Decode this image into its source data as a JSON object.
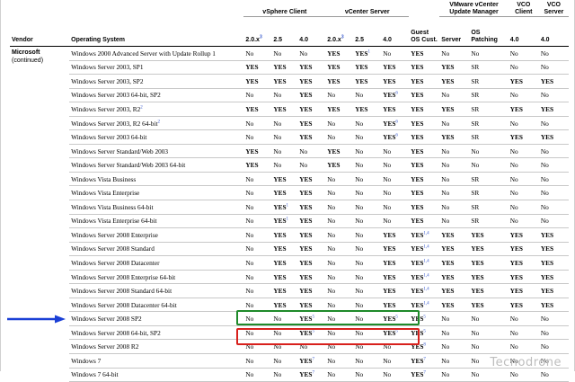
{
  "header": {
    "groups": [
      {
        "key": "vendor",
        "label": ""
      },
      {
        "key": "os",
        "label": ""
      },
      {
        "key": "vsphere",
        "label": "vSphere Client",
        "span": 3
      },
      {
        "key": "vcenter",
        "label": "vCenter Server",
        "span": 3
      },
      {
        "key": "guest",
        "label": ""
      },
      {
        "key": "vum",
        "label": "VMware vCenter Update Manager",
        "span": 2
      },
      {
        "key": "vco_client",
        "label": "VCO Client"
      },
      {
        "key": "vco_server",
        "label": "VCO Server"
      }
    ],
    "columns": [
      {
        "label": "Vendor"
      },
      {
        "label": "Operating System"
      },
      {
        "label": "2.0.x",
        "fn": "3"
      },
      {
        "label": "2.5"
      },
      {
        "label": "4.0"
      },
      {
        "label": "2.0.x",
        "fn": "3"
      },
      {
        "label": "2.5"
      },
      {
        "label": "4.0"
      },
      {
        "label": "Guest OS Cust."
      },
      {
        "label": "Server"
      },
      {
        "label": "OS Patching"
      },
      {
        "label": "4.0"
      },
      {
        "label": "4.0"
      }
    ]
  },
  "vendor": {
    "name": "Microsoft",
    "note": "(continued)"
  },
  "rows": [
    {
      "os": "Windows 2000 Advanced Server with Update Rollup 1",
      "cells": [
        [
          "No"
        ],
        [
          "No"
        ],
        [
          "No"
        ],
        [
          "YES"
        ],
        [
          "YES",
          "1"
        ],
        [
          "No"
        ],
        [
          "YES"
        ],
        [
          "No"
        ],
        [
          "No"
        ],
        [
          "No"
        ],
        [
          "No"
        ]
      ]
    },
    {
      "os": "Windows Server 2003, SP1",
      "cells": [
        [
          "YES"
        ],
        [
          "YES"
        ],
        [
          "YES"
        ],
        [
          "YES"
        ],
        [
          "YES"
        ],
        [
          "YES"
        ],
        [
          "YES"
        ],
        [
          "YES"
        ],
        [
          "SR"
        ],
        [
          "No"
        ],
        [
          "No"
        ]
      ]
    },
    {
      "os": "Windows Server 2003, SP2",
      "cells": [
        [
          "YES"
        ],
        [
          "YES"
        ],
        [
          "YES"
        ],
        [
          "YES"
        ],
        [
          "YES"
        ],
        [
          "YES"
        ],
        [
          "YES"
        ],
        [
          "YES"
        ],
        [
          "SR"
        ],
        [
          "YES"
        ],
        [
          "YES"
        ]
      ]
    },
    {
      "os": "Windows Server 2003 64-bit, SP2",
      "cells": [
        [
          "No"
        ],
        [
          "No"
        ],
        [
          "YES"
        ],
        [
          "No"
        ],
        [
          "No"
        ],
        [
          "YES",
          "6"
        ],
        [
          "YES"
        ],
        [
          "No"
        ],
        [
          "SR"
        ],
        [
          "No"
        ],
        [
          "No"
        ]
      ]
    },
    {
      "os": "Windows Server 2003, R2",
      "fn": "2",
      "cells": [
        [
          "YES"
        ],
        [
          "YES"
        ],
        [
          "YES"
        ],
        [
          "YES"
        ],
        [
          "YES"
        ],
        [
          "YES"
        ],
        [
          "YES"
        ],
        [
          "YES"
        ],
        [
          "SR"
        ],
        [
          "YES"
        ],
        [
          "YES"
        ]
      ]
    },
    {
      "os": "Windows Server 2003, R2 64-bit",
      "fn": "2",
      "cells": [
        [
          "No"
        ],
        [
          "No"
        ],
        [
          "YES"
        ],
        [
          "No"
        ],
        [
          "No"
        ],
        [
          "YES",
          "6"
        ],
        [
          "YES"
        ],
        [
          "No"
        ],
        [
          "SR"
        ],
        [
          "No"
        ],
        [
          "No"
        ]
      ]
    },
    {
      "os": "Windows Server 2003 64-bit",
      "cells": [
        [
          "No"
        ],
        [
          "No"
        ],
        [
          "YES"
        ],
        [
          "No"
        ],
        [
          "No"
        ],
        [
          "YES",
          "6"
        ],
        [
          "YES"
        ],
        [
          "YES"
        ],
        [
          "SR"
        ],
        [
          "YES"
        ],
        [
          "YES"
        ]
      ]
    },
    {
      "os": "Windows Server Standard/Web 2003",
      "cells": [
        [
          "YES"
        ],
        [
          "No"
        ],
        [
          "No"
        ],
        [
          "YES"
        ],
        [
          "No"
        ],
        [
          "No"
        ],
        [
          "YES"
        ],
        [
          "No"
        ],
        [
          "No"
        ],
        [
          "No"
        ],
        [
          "No"
        ]
      ]
    },
    {
      "os": "Windows Server Standard/Web 2003 64-bit",
      "cells": [
        [
          "YES"
        ],
        [
          "No"
        ],
        [
          "No"
        ],
        [
          "YES"
        ],
        [
          "No"
        ],
        [
          "No"
        ],
        [
          "YES"
        ],
        [
          "No"
        ],
        [
          "No"
        ],
        [
          "No"
        ],
        [
          "No"
        ]
      ]
    },
    {
      "os": "Windows Vista Business",
      "cells": [
        [
          "No"
        ],
        [
          "YES"
        ],
        [
          "YES"
        ],
        [
          "No"
        ],
        [
          "No"
        ],
        [
          "No"
        ],
        [
          "YES"
        ],
        [
          "No"
        ],
        [
          "SR"
        ],
        [
          "No"
        ],
        [
          "No"
        ]
      ]
    },
    {
      "os": "Windows Vista Enterprise",
      "cells": [
        [
          "No"
        ],
        [
          "YES"
        ],
        [
          "YES"
        ],
        [
          "No"
        ],
        [
          "No"
        ],
        [
          "No"
        ],
        [
          "YES"
        ],
        [
          "No"
        ],
        [
          "SR"
        ],
        [
          "No"
        ],
        [
          "No"
        ]
      ]
    },
    {
      "os": "Windows Vista Business 64-bit",
      "cells": [
        [
          "No"
        ],
        [
          "YES",
          "1"
        ],
        [
          "YES"
        ],
        [
          "No"
        ],
        [
          "No"
        ],
        [
          "No"
        ],
        [
          "YES"
        ],
        [
          "No"
        ],
        [
          "SR"
        ],
        [
          "No"
        ],
        [
          "No"
        ]
      ]
    },
    {
      "os": "Windows Vista Enterprise 64-bit",
      "cells": [
        [
          "No"
        ],
        [
          "YES",
          "1"
        ],
        [
          "YES"
        ],
        [
          "No"
        ],
        [
          "No"
        ],
        [
          "No"
        ],
        [
          "YES"
        ],
        [
          "No"
        ],
        [
          "SR"
        ],
        [
          "No"
        ],
        [
          "No"
        ]
      ]
    },
    {
      "os": "Windows Server 2008 Enterprise",
      "cells": [
        [
          "No"
        ],
        [
          "YES"
        ],
        [
          "YES"
        ],
        [
          "No"
        ],
        [
          "No"
        ],
        [
          "YES"
        ],
        [
          "YES",
          "1,4"
        ],
        [
          "YES"
        ],
        [
          "YES"
        ],
        [
          "YES"
        ],
        [
          "YES"
        ]
      ]
    },
    {
      "os": "Windows Server 2008 Standard",
      "cells": [
        [
          "No"
        ],
        [
          "YES"
        ],
        [
          "YES"
        ],
        [
          "No"
        ],
        [
          "No"
        ],
        [
          "YES"
        ],
        [
          "YES",
          "1,4"
        ],
        [
          "YES"
        ],
        [
          "YES"
        ],
        [
          "YES"
        ],
        [
          "YES"
        ]
      ]
    },
    {
      "os": "Windows Server 2008 Datacenter",
      "cells": [
        [
          "No"
        ],
        [
          "YES"
        ],
        [
          "YES"
        ],
        [
          "No"
        ],
        [
          "No"
        ],
        [
          "YES"
        ],
        [
          "YES",
          "1,4"
        ],
        [
          "YES"
        ],
        [
          "YES"
        ],
        [
          "YES"
        ],
        [
          "YES"
        ]
      ]
    },
    {
      "os": "Windows Server 2008 Enterprise 64-bit",
      "cells": [
        [
          "No"
        ],
        [
          "YES"
        ],
        [
          "YES"
        ],
        [
          "No"
        ],
        [
          "No"
        ],
        [
          "YES"
        ],
        [
          "YES",
          "1,4"
        ],
        [
          "YES"
        ],
        [
          "YES"
        ],
        [
          "YES"
        ],
        [
          "YES"
        ]
      ]
    },
    {
      "os": "Windows Server 2008 Standard 64-bit",
      "cells": [
        [
          "No"
        ],
        [
          "YES"
        ],
        [
          "YES"
        ],
        [
          "No"
        ],
        [
          "No"
        ],
        [
          "YES"
        ],
        [
          "YES",
          "1,4"
        ],
        [
          "YES"
        ],
        [
          "YES"
        ],
        [
          "YES"
        ],
        [
          "YES"
        ]
      ]
    },
    {
      "os": "Windows Server 2008 Datacenter 64-bit",
      "cells": [
        [
          "No"
        ],
        [
          "YES"
        ],
        [
          "YES"
        ],
        [
          "No"
        ],
        [
          "No"
        ],
        [
          "YES"
        ],
        [
          "YES",
          "1,4"
        ],
        [
          "YES"
        ],
        [
          "YES"
        ],
        [
          "YES"
        ],
        [
          "YES"
        ]
      ]
    },
    {
      "os": "Windows Server 2008 SP2",
      "cells": [
        [
          "No"
        ],
        [
          "No"
        ],
        [
          "YES",
          "5"
        ],
        [
          "No"
        ],
        [
          "No"
        ],
        [
          "YES",
          "5"
        ],
        [
          "YES",
          "5"
        ],
        [
          "No"
        ],
        [
          "No"
        ],
        [
          "No"
        ],
        [
          "No"
        ]
      ]
    },
    {
      "os": "Windows Server 2008 64-bit, SP2",
      "cells": [
        [
          "No"
        ],
        [
          "No"
        ],
        [
          "YES",
          "5"
        ],
        [
          "No"
        ],
        [
          "No"
        ],
        [
          "YES",
          "5"
        ],
        [
          "YES",
          "5"
        ],
        [
          "No"
        ],
        [
          "No"
        ],
        [
          "No"
        ],
        [
          "No"
        ]
      ]
    },
    {
      "os": "Windows Server 2008 R2",
      "cells": [
        [
          "No"
        ],
        [
          "No"
        ],
        [
          "No"
        ],
        [
          "No"
        ],
        [
          "No"
        ],
        [
          "No"
        ],
        [
          "YES",
          "8"
        ],
        [
          "No"
        ],
        [
          "No"
        ],
        [
          "No"
        ],
        [
          "No"
        ]
      ]
    },
    {
      "os": "Windows 7",
      "cells": [
        [
          "No"
        ],
        [
          "No"
        ],
        [
          "YES",
          "7"
        ],
        [
          "No"
        ],
        [
          "No"
        ],
        [
          "No"
        ],
        [
          "YES",
          "7"
        ],
        [
          "No"
        ],
        [
          "No"
        ],
        [
          "No"
        ],
        [
          "No"
        ]
      ]
    },
    {
      "os": "Windows 7 64-bit",
      "cells": [
        [
          "No"
        ],
        [
          "No"
        ],
        [
          "YES",
          "7"
        ],
        [
          "No"
        ],
        [
          "No"
        ],
        [
          "No"
        ],
        [
          "YES",
          "7"
        ],
        [
          "No"
        ],
        [
          "No"
        ],
        [
          "No"
        ],
        [
          "No"
        ]
      ]
    }
  ],
  "watermark": "Tecnodrone",
  "colors": {
    "highlight_green": "#1f8a2a",
    "highlight_red": "#d8201c",
    "arrow_blue": "#1a3fd6",
    "footnote_blue": "#3355cc"
  },
  "icons": {
    "arrow": "arrow-right-icon"
  }
}
